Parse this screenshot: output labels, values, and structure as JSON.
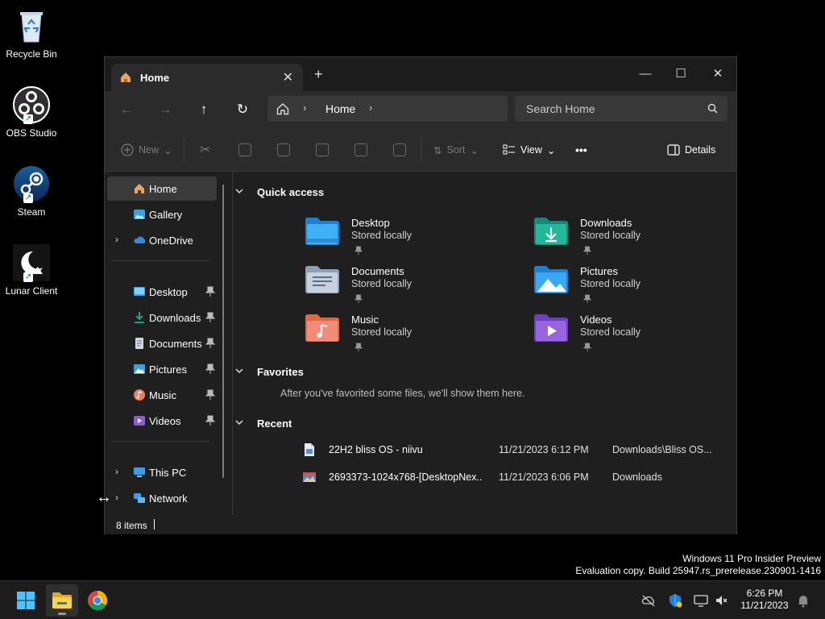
{
  "desktop": {
    "icons": [
      {
        "label": "Recycle Bin",
        "icon": "recycle-bin-icon"
      },
      {
        "label": "OBS Studio",
        "icon": "obs-icon"
      },
      {
        "label": "Steam",
        "icon": "steam-icon"
      },
      {
        "label": "Lunar Client",
        "icon": "lunar-client-icon"
      }
    ],
    "watermark": {
      "line1": "Windows 11 Pro Insider Preview",
      "line2": "Evaluation copy. Build 25947.rs_prerelease.230901-1416"
    }
  },
  "window": {
    "tab": {
      "title": "Home",
      "close": "✕"
    },
    "new_tab": "+",
    "controls": {
      "minimize": "—",
      "maximize": "☐",
      "close": "✕"
    },
    "nav": {
      "back": "←",
      "forward": "→",
      "up": "↑",
      "refresh": "↻"
    },
    "address": {
      "crumb": "Home",
      "sep": "›"
    },
    "search": {
      "placeholder": "Search Home"
    },
    "command_bar": {
      "new_label": "New",
      "sort_label": "Sort",
      "view_label": "View",
      "more_label": "•••",
      "details_label": "Details",
      "dropdown": "⌄"
    },
    "sidebar": {
      "top": [
        {
          "label": "Home"
        },
        {
          "label": "Gallery"
        },
        {
          "label": "OneDrive",
          "expander": "›"
        }
      ],
      "pinned": [
        {
          "label": "Desktop"
        },
        {
          "label": "Downloads"
        },
        {
          "label": "Documents"
        },
        {
          "label": "Pictures"
        },
        {
          "label": "Music"
        },
        {
          "label": "Videos"
        }
      ],
      "bottom": [
        {
          "label": "This PC",
          "expander": "›"
        },
        {
          "label": "Network",
          "expander": "›"
        }
      ]
    },
    "quick_access": {
      "title": "Quick access",
      "items": [
        {
          "name": "Desktop",
          "sub": "Stored locally"
        },
        {
          "name": "Downloads",
          "sub": "Stored locally"
        },
        {
          "name": "Documents",
          "sub": "Stored locally"
        },
        {
          "name": "Pictures",
          "sub": "Stored locally"
        },
        {
          "name": "Music",
          "sub": "Stored locally"
        },
        {
          "name": "Videos",
          "sub": "Stored locally"
        }
      ]
    },
    "favorites": {
      "title": "Favorites",
      "note": "After you've favorited some files, we'll show them here."
    },
    "recent": {
      "title": "Recent",
      "rows": [
        {
          "name": "22H2 bliss OS - niivu",
          "date": "11/21/2023 6:12 PM",
          "location": "Downloads\\Bliss OS..."
        },
        {
          "name": "2693373-1024x768-[DesktopNex...",
          "date": "11/21/2023 6:06 PM",
          "location": "Downloads"
        }
      ]
    },
    "status": {
      "items": "8 items"
    }
  },
  "taskbar": {
    "clock": {
      "time": "6:26 PM",
      "date": "11/21/2023"
    }
  },
  "colors": {
    "accent_blue": "#4cc2ff",
    "folder_blue": "#3b9ee8",
    "folder_green": "#1fae8f",
    "window_bg": "#1f1f1f",
    "toolbar_bg": "#2b2b2b"
  }
}
